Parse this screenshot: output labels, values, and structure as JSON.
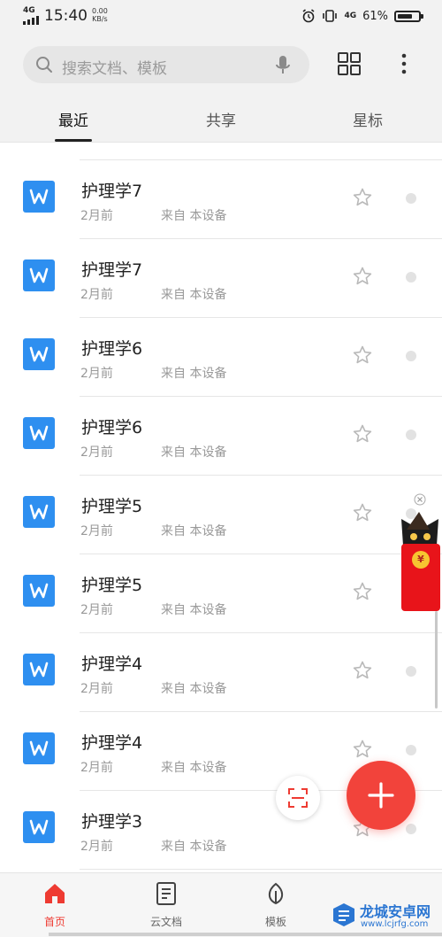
{
  "status_bar": {
    "network": "4G",
    "time": "15:40",
    "speed_value": "0.00",
    "speed_unit": "KB/s",
    "network_right": "4G",
    "battery": "61%"
  },
  "search": {
    "placeholder": "搜索文档、模板",
    "icon": "search-icon"
  },
  "header_icons": [
    "grid-view-icon",
    "more-icon"
  ],
  "tabs": [
    {
      "label": "最近",
      "active": true
    },
    {
      "label": "共享",
      "active": false
    },
    {
      "label": "星标",
      "active": false
    }
  ],
  "files": [
    {
      "title": "护理学7",
      "time": "2月前",
      "source": "来自 本设备"
    },
    {
      "title": "护理学7",
      "time": "2月前",
      "source": "来自 本设备"
    },
    {
      "title": "护理学6",
      "time": "2月前",
      "source": "来自 本设备"
    },
    {
      "title": "护理学6",
      "time": "2月前",
      "source": "来自 本设备"
    },
    {
      "title": "护理学5",
      "time": "2月前",
      "source": "来自 本设备"
    },
    {
      "title": "护理学5",
      "time": "2月前",
      "source": "来自 本设备"
    },
    {
      "title": "护理学4",
      "time": "2月前",
      "source": "来自 本设备"
    },
    {
      "title": "护理学4",
      "time": "2月前",
      "source": "来自 本设备"
    },
    {
      "title": "护理学3",
      "time": "2月前",
      "source": "来自 本设备"
    }
  ],
  "file_icon_letter": "W",
  "promo": {
    "coin": "¥"
  },
  "bottom_nav": [
    {
      "label": "首页",
      "icon": "home-icon",
      "active": true
    },
    {
      "label": "云文档",
      "icon": "cloud-doc-icon",
      "active": false
    },
    {
      "label": "模板",
      "icon": "template-leaf-icon",
      "active": false
    }
  ],
  "watermark": {
    "text": "龙城安卓网",
    "url": "www.lcjrfg.com"
  },
  "colors": {
    "accent": "#f2433b",
    "doc_blue": "#2e8ff0",
    "active_tab_underline": "#222222",
    "muted_text": "#999999"
  }
}
